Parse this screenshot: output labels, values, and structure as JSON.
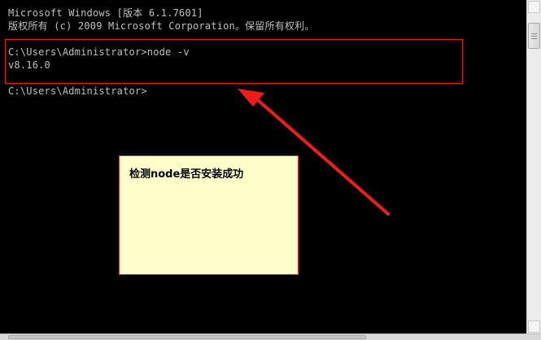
{
  "console": {
    "lines": [
      "Microsoft Windows [版本 6.1.7601]",
      "版权所有 (c) 2009 Microsoft Corporation。保留所有权利。",
      "C:\\Users\\Administrator>node -v",
      "v8.16.0",
      "C:\\Users\\Administrator>"
    ]
  },
  "annotation": {
    "text": "检测node是否安装成功",
    "color": "#ee1c1c",
    "note_background": "#ffffcc"
  },
  "colors": {
    "console_background": "#000000",
    "console_text": "#c0c0c0"
  }
}
